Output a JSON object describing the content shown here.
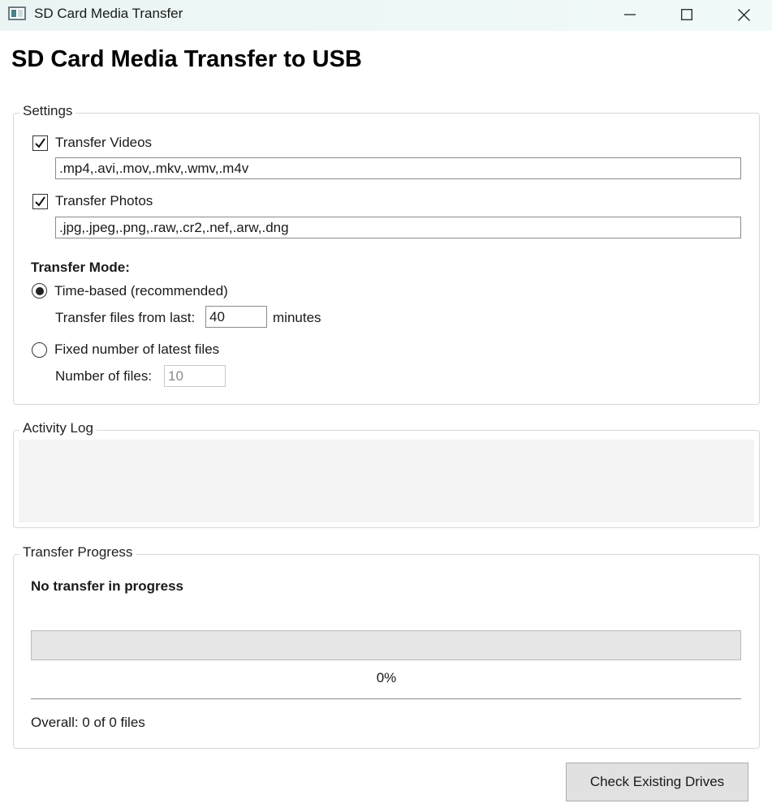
{
  "window": {
    "title": "SD Card Media Transfer",
    "icon": "app-window-icon",
    "controls": [
      "minimize-icon",
      "maximize-icon",
      "close-icon"
    ]
  },
  "header": {
    "title": "SD Card Media Transfer to USB"
  },
  "settings": {
    "legend": "Settings",
    "videos": {
      "label": "Transfer Videos",
      "checked": true,
      "extensions": ".mp4,.avi,.mov,.mkv,.wmv,.m4v"
    },
    "photos": {
      "label": "Transfer Photos",
      "checked": true,
      "extensions": ".jpg,.jpeg,.png,.raw,.cr2,.nef,.arw,.dng"
    },
    "mode": {
      "heading": "Transfer Mode:",
      "time_based": {
        "label": "Time-based (recommended)",
        "selected": true,
        "prefix": "Transfer files from last:",
        "value": "40",
        "suffix": "minutes"
      },
      "fixed": {
        "label": "Fixed number of latest files",
        "selected": false,
        "prefix": "Number of files:",
        "value": "10"
      }
    }
  },
  "log": {
    "legend": "Activity Log",
    "entries": []
  },
  "progress": {
    "legend": "Transfer Progress",
    "status": "No transfer in progress",
    "percent_value": 0,
    "percent_text": "0%",
    "overall": "Overall: 0 of 0 files"
  },
  "actions": {
    "check_drives": "Check Existing Drives"
  },
  "colors": {
    "titlebar": "#eaf5f3",
    "button_bg": "#e1e1e1",
    "log_bg": "#f4f4f4",
    "progress_track": "#e6e6e6"
  }
}
